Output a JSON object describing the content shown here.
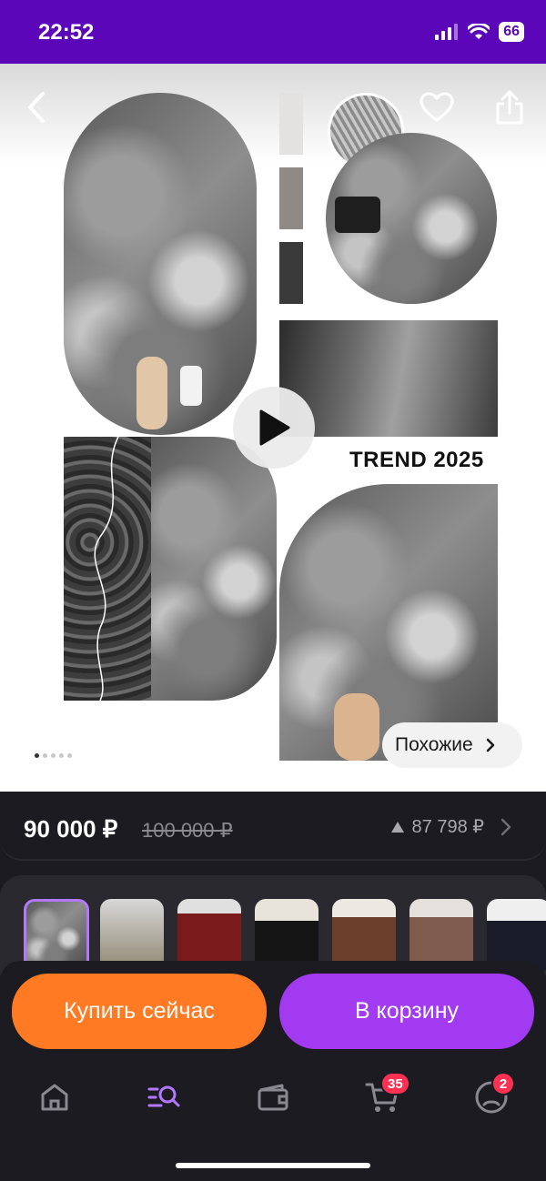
{
  "status_bar": {
    "time": "22:52",
    "battery": "66"
  },
  "product": {
    "banner_text": "TREND 2025",
    "similar_label": "Похожие"
  },
  "gallery": {
    "images_count": 5,
    "current_image": 1
  },
  "price": {
    "current": "90 000 ₽",
    "old": "100 000 ₽",
    "alt": "87 798 ₽"
  },
  "variants": {
    "count": 7,
    "selected": 1
  },
  "actions": {
    "buy_now": "Купить сейчас",
    "add_to_cart": "В корзину"
  },
  "nav": {
    "items": [
      "home-icon",
      "catalog-search-icon",
      "wallet-icon",
      "cart-icon",
      "profile-icon"
    ],
    "cart_badge": "35",
    "profile_badge": "2",
    "active": "catalog-search-icon"
  },
  "colors": {
    "status_bar": "#5b06b8",
    "buy_now": "#ff7a22",
    "add_to_cart": "#a23af2",
    "badge": "#ff3152",
    "active_nav": "#b478ff"
  }
}
